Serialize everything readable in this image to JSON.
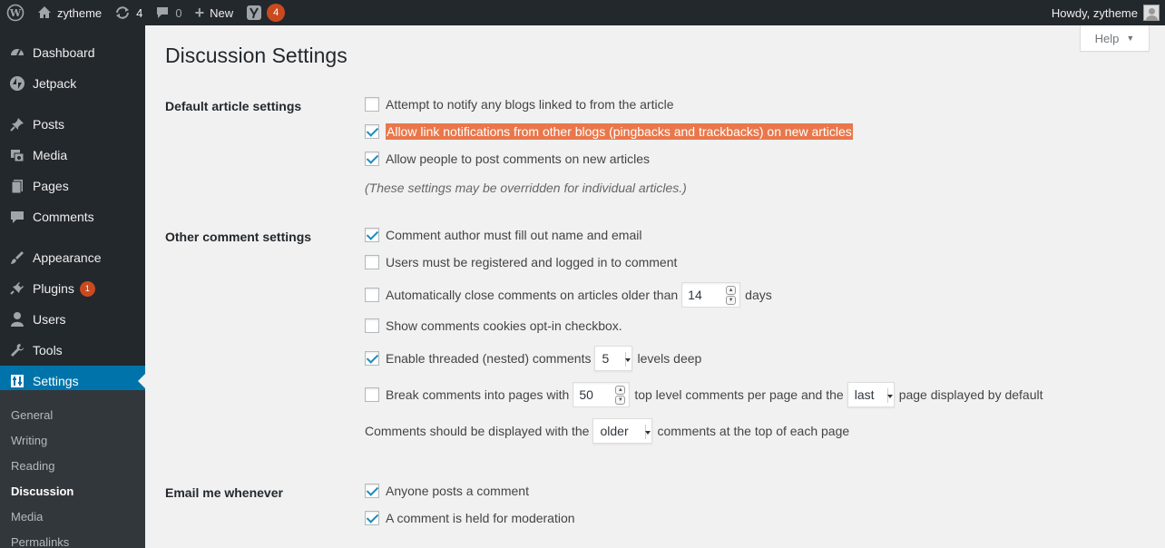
{
  "adminbar": {
    "site_name": "zytheme",
    "updates_count": "4",
    "comments_count": "0",
    "new_label": "New",
    "yoast_count": "4",
    "howdy": "Howdy, zytheme"
  },
  "sidebar": {
    "items": [
      {
        "label": "Dashboard",
        "icon": "dashboard-icon"
      },
      {
        "label": "Jetpack",
        "icon": "jetpack-icon"
      },
      {
        "label": "Posts",
        "icon": "pin-icon"
      },
      {
        "label": "Media",
        "icon": "media-icon"
      },
      {
        "label": "Pages",
        "icon": "pages-icon"
      },
      {
        "label": "Comments",
        "icon": "comment-icon"
      },
      {
        "label": "Appearance",
        "icon": "paintbrush-icon"
      },
      {
        "label": "Plugins",
        "icon": "plugin-icon",
        "badge": "1"
      },
      {
        "label": "Users",
        "icon": "users-icon"
      },
      {
        "label": "Tools",
        "icon": "wrench-icon"
      },
      {
        "label": "Settings",
        "icon": "settings-icon"
      }
    ],
    "submenu": [
      "General",
      "Writing",
      "Reading",
      "Discussion",
      "Media",
      "Permalinks"
    ]
  },
  "help_label": "Help",
  "page_title": "Discussion Settings",
  "sections": {
    "default_article": {
      "label": "Default article settings",
      "options": [
        {
          "label": "Attempt to notify any blogs linked to from the article",
          "checked": false
        },
        {
          "label": "Allow link notifications from other blogs (pingbacks and trackbacks) on new articles",
          "checked": true
        },
        {
          "label": "Allow people to post comments on new articles",
          "checked": true
        }
      ],
      "description": "(These settings may be overridden for individual articles.)"
    },
    "other_comment": {
      "label": "Other comment settings",
      "author_fill": {
        "label": "Comment author must fill out name and email",
        "checked": true
      },
      "registered": {
        "label": "Users must be registered and logged in to comment",
        "checked": false
      },
      "auto_close": {
        "label_before": "Automatically close comments on articles older than",
        "value": "14",
        "label_after": "days",
        "checked": false
      },
      "cookies": {
        "label": "Show comments cookies opt-in checkbox.",
        "checked": false
      },
      "threaded": {
        "label_before": "Enable threaded (nested) comments",
        "value": "5",
        "label_after": "levels deep",
        "checked": true
      },
      "paging": {
        "label_before": "Break comments into pages with",
        "value": "50",
        "label_mid": "top level comments per page and the",
        "select_value": "last",
        "label_after": "page displayed by default",
        "checked": false
      },
      "order": {
        "label_before": "Comments should be displayed with the",
        "select_value": "older",
        "label_after": "comments at the top of each page"
      }
    },
    "email": {
      "label": "Email me whenever",
      "options": [
        {
          "label": "Anyone posts a comment",
          "checked": true
        },
        {
          "label": "A comment is held for moderation",
          "checked": true
        }
      ]
    }
  },
  "colors": {
    "adminbar_bg": "#23282d",
    "accent": "#0073aa",
    "highlight": "#e9774b",
    "badge": "#ca4a1f"
  }
}
